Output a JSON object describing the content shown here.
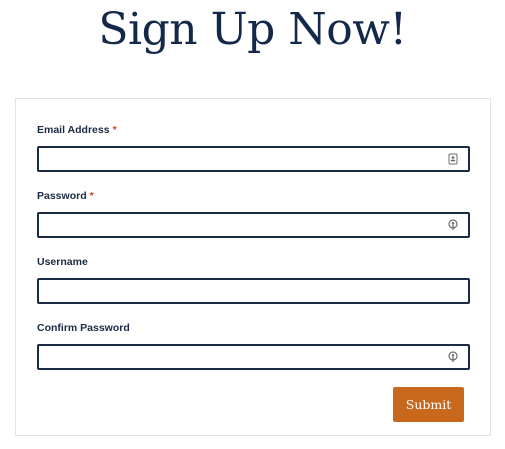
{
  "page": {
    "title": "Sign Up Now!"
  },
  "form": {
    "fields": [
      {
        "label": "Email Address",
        "required_mark": "*",
        "value": "",
        "icon": "contact-card-icon"
      },
      {
        "label": "Password",
        "required_mark": "*",
        "value": "",
        "icon": "key-icon"
      },
      {
        "label": "Username",
        "required_mark": "",
        "value": ""
      },
      {
        "label": "Confirm Password",
        "required_mark": "",
        "value": "",
        "icon": "key-icon"
      }
    ],
    "submit_label": "Submit"
  },
  "colors": {
    "title": "#14284a",
    "field_border": "#1b2a44",
    "required": "#d63a2c",
    "submit_bg": "#c8681c",
    "card_border": "#e3e3e3"
  }
}
